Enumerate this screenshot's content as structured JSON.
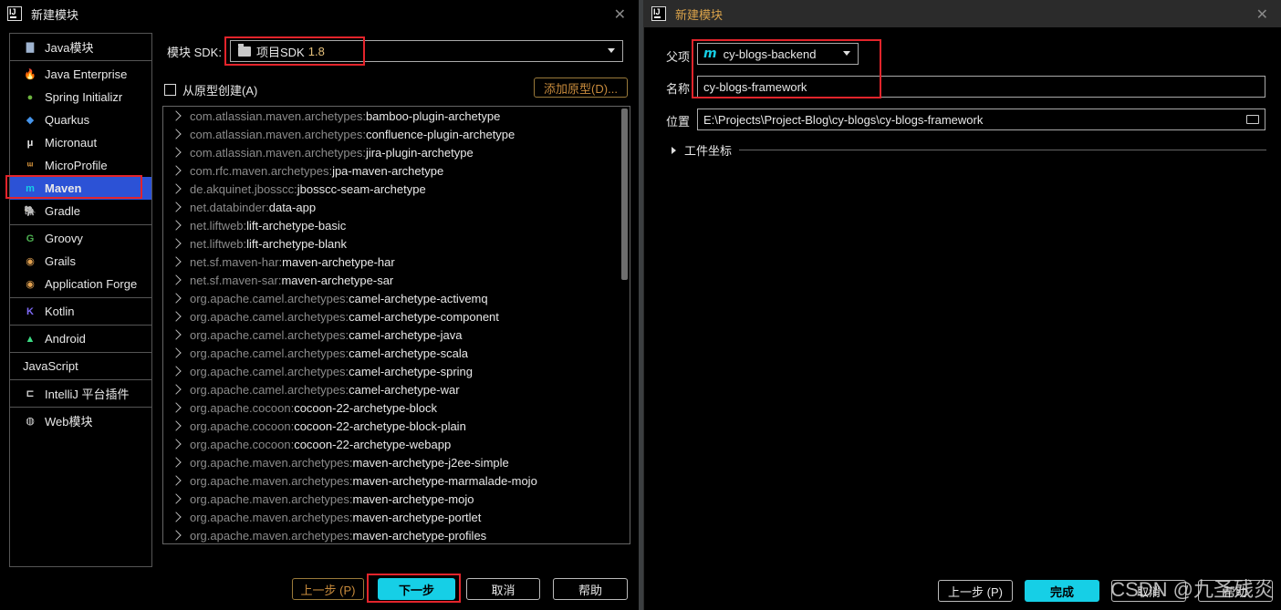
{
  "left": {
    "title": "新建模块",
    "modules": [
      [
        {
          "label": "Java模块",
          "icon": "folder-icon"
        }
      ],
      [
        {
          "label": "Java Enterprise",
          "icon": "java-enterprise-icon"
        },
        {
          "label": "Spring Initializr",
          "icon": "spring-icon"
        },
        {
          "label": "Quarkus",
          "icon": "quarkus-icon"
        },
        {
          "label": "Micronaut",
          "icon": "micronaut-icon"
        },
        {
          "label": "MicroProfile",
          "icon": "microprofile-icon"
        },
        {
          "label": "Maven",
          "icon": "maven-icon",
          "selected": true
        },
        {
          "label": "Gradle",
          "icon": "gradle-icon"
        }
      ],
      [
        {
          "label": "Groovy",
          "icon": "groovy-icon"
        },
        {
          "label": "Grails",
          "icon": "grails-icon"
        },
        {
          "label": "Application Forge",
          "icon": "forge-icon"
        }
      ],
      [
        {
          "label": "Kotlin",
          "icon": "kotlin-icon"
        }
      ],
      [
        {
          "label": "Android",
          "icon": "android-icon"
        }
      ],
      [
        {
          "label": "JavaScript",
          "icon": ""
        }
      ],
      [
        {
          "label": "IntelliJ 平台插件",
          "icon": "plugin-icon"
        }
      ],
      [
        {
          "label": "Web模块",
          "icon": "globe-icon"
        }
      ]
    ],
    "sdk_label": "模块 SDK:",
    "sdk_value": "项目SDK",
    "sdk_version": "1.8",
    "create_from_archetype": "从原型创建(A)",
    "add_archetype": "添加原型(D)...",
    "archetypes": [
      [
        "com.atlassian.maven.archetypes:",
        "bamboo-plugin-archetype"
      ],
      [
        "com.atlassian.maven.archetypes:",
        "confluence-plugin-archetype"
      ],
      [
        "com.atlassian.maven.archetypes:",
        "jira-plugin-archetype"
      ],
      [
        "com.rfc.maven.archetypes:",
        "jpa-maven-archetype"
      ],
      [
        "de.akquinet.jbosscc:",
        "jbosscc-seam-archetype"
      ],
      [
        "net.databinder:",
        "data-app"
      ],
      [
        "net.liftweb:",
        "lift-archetype-basic"
      ],
      [
        "net.liftweb:",
        "lift-archetype-blank"
      ],
      [
        "net.sf.maven-har:",
        "maven-archetype-har"
      ],
      [
        "net.sf.maven-sar:",
        "maven-archetype-sar"
      ],
      [
        "org.apache.camel.archetypes:",
        "camel-archetype-activemq"
      ],
      [
        "org.apache.camel.archetypes:",
        "camel-archetype-component"
      ],
      [
        "org.apache.camel.archetypes:",
        "camel-archetype-java"
      ],
      [
        "org.apache.camel.archetypes:",
        "camel-archetype-scala"
      ],
      [
        "org.apache.camel.archetypes:",
        "camel-archetype-spring"
      ],
      [
        "org.apache.camel.archetypes:",
        "camel-archetype-war"
      ],
      [
        "org.apache.cocoon:",
        "cocoon-22-archetype-block"
      ],
      [
        "org.apache.cocoon:",
        "cocoon-22-archetype-block-plain"
      ],
      [
        "org.apache.cocoon:",
        "cocoon-22-archetype-webapp"
      ],
      [
        "org.apache.maven.archetypes:",
        "maven-archetype-j2ee-simple"
      ],
      [
        "org.apache.maven.archetypes:",
        "maven-archetype-marmalade-mojo"
      ],
      [
        "org.apache.maven.archetypes:",
        "maven-archetype-mojo"
      ],
      [
        "org.apache.maven.archetypes:",
        "maven-archetype-portlet"
      ],
      [
        "org.apache.maven.archetypes:",
        "maven-archetype-profiles"
      ]
    ],
    "buttons": {
      "prev": "上一步 (P)",
      "next": "下一步",
      "cancel": "取消",
      "help": "帮助"
    }
  },
  "right": {
    "title": "新建模块",
    "parent_label": "父项",
    "parent_value": "cy-blogs-backend",
    "name_label": "名称",
    "name_value": "cy-blogs-framework",
    "location_label": "位置",
    "location_value": "E:\\Projects\\Project-Blog\\cy-blogs\\cy-blogs-framework",
    "coords_label": "工件坐标",
    "buttons": {
      "prev": "上一步 (P)",
      "finish": "完成",
      "cancel": "取消",
      "help": "帮助"
    },
    "watermark": "CSDN @九圣残炎"
  }
}
